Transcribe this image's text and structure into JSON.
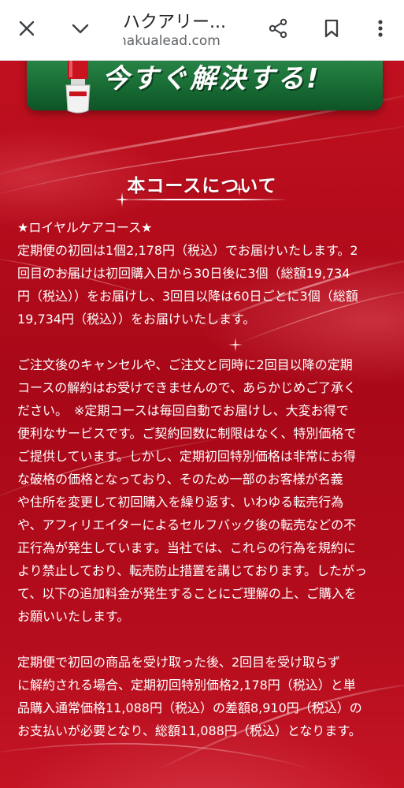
{
  "browser": {
    "title": "ハクアリー...",
    "url": "hakualead.com",
    "icons": [
      "close-icon",
      "chevron-down-icon",
      "share-icon",
      "bookmark-icon",
      "more-vert-icon"
    ]
  },
  "banner": {
    "text": "今すぐ解決する!"
  },
  "section": {
    "heading": "本コースについて"
  },
  "content": {
    "course_title": "★ロイヤルケアコース★",
    "p1": "定期便の初回は1個2,178円（税込）でお届けいたします。2\n回目のお届けは初回購入日から30日後に3個（総額19,734\n円（税込））をお届けし、3回目以降は60日ごとに3個（総額\n19,734円（税込））をお届けいたします。",
    "p2": "ご注文後のキャンセルや、ご注文と同時に2回目以降の定期\nコースの解約はお受けできませんので、あらかじめご了承く\nださい。　※定期コースは毎回自動でお届けし、大変お得で\n便利なサービスです。ご契約回数に制限はなく、特別価格で\nご提供しています。しかし、定期初回特別価格は非常にお得\nな破格の価格となっており、そのため一部のお客様が名義\nや住所を変更して初回購入を繰り返す、いわゆる転売行為\nや、アフィリエイターによるセルフバック後の転売などの不\n正行為が発生しています。当社では、これらの行為を規約に\nより禁止しており、転売防止措置を講じております。したがっ\nて、以下の追加料金が発生することにご理解の上、ご購入を\nお願いいたします。",
    "p3": "定期便で初回の商品を受け取った後、2回目を受け取らず\nに解約される場合、定期初回特別価格2,178円（税込）と単\n品購入通常価格11,088円（税込）の差額8,910円（税込）の\nお支払いが必要となり、総額11,088円（税込）となります。"
  },
  "colors": {
    "page_red": "#b30c1d",
    "banner_green": "#176a33",
    "text_white": "#ffffff"
  }
}
